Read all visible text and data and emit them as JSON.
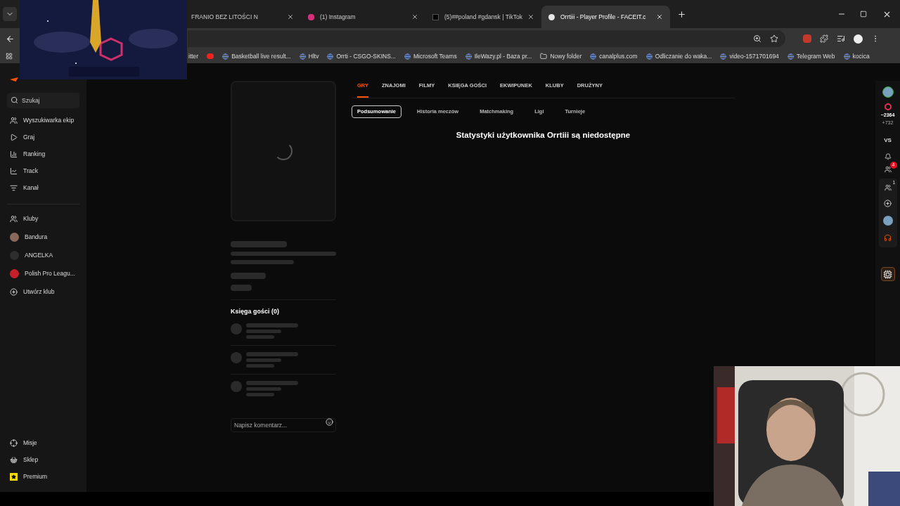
{
  "browser": {
    "tabs": [
      {
        "title": "FRANIO BEZ LITOŚCI N",
        "selected": false
      },
      {
        "title": "(1) Instagram",
        "selected": false
      },
      {
        "title": "(5)##poland #gdansk | TikTok",
        "selected": false
      },
      {
        "title": "Orrtiii - Player Profile - FACEIT.c",
        "selected": true
      }
    ],
    "bookmarks": [
      "itter",
      "Basketball live result...",
      "Hltv",
      "Orrti - CSGO-SKINS...",
      "Microsoft Teams",
      "IleWazy.pl - Baza pr...",
      "Nowy folder",
      "canalplus.com",
      "Odliczanie do waka...",
      "video-1571701694",
      "Telegram Web",
      "kocica"
    ]
  },
  "sidebar": {
    "search": {
      "placeholder": "Szukaj"
    },
    "nav": [
      {
        "label": "Wyszukiwarka ekip"
      },
      {
        "label": "Graj"
      },
      {
        "label": "Ranking"
      },
      {
        "label": "Track"
      },
      {
        "label": "Kanał"
      }
    ],
    "clubs": [
      {
        "label": "Kluby",
        "kind": "icon"
      },
      {
        "label": "Bandura",
        "kind": "avatar"
      },
      {
        "label": "ANGELKA",
        "kind": "avatar"
      },
      {
        "label": "Polish Pro Leagu...",
        "kind": "badge"
      },
      {
        "label": "Utwórz klub",
        "kind": "icon"
      }
    ],
    "bottom": [
      {
        "label": "Misje"
      },
      {
        "label": "Sklep"
      },
      {
        "label": "Premium"
      }
    ]
  },
  "profile": {
    "guestbook_title": "Księga gości (0)",
    "comment": {
      "placeholder": "Napisz komentarz..."
    }
  },
  "tabs": [
    {
      "label": "GRY",
      "selected": true
    },
    {
      "label": "ZNAJOMI",
      "selected": false
    },
    {
      "label": "FILMY",
      "selected": false
    },
    {
      "label": "KSIĘGA GOŚCI",
      "selected": false
    },
    {
      "label": "EKWIPUNEK",
      "selected": false
    },
    {
      "label": "KLUBY",
      "selected": false
    },
    {
      "label": "DRUŻYNY",
      "selected": false
    }
  ],
  "subtabs": [
    {
      "label": "Podsumowanie",
      "selected": true
    },
    {
      "label": "Historia meczów",
      "selected": false
    },
    {
      "label": "Matchmaking",
      "selected": false
    },
    {
      "label": "Ligi",
      "selected": false
    },
    {
      "label": "Turnieje",
      "selected": false
    }
  ],
  "message": "Statystyki użytkownika Orrtiii są niedostępne",
  "rail": {
    "elo": "~2364",
    "elo_change": "+732",
    "vs": "VS",
    "friend_requests": "4",
    "party_count": "1"
  }
}
